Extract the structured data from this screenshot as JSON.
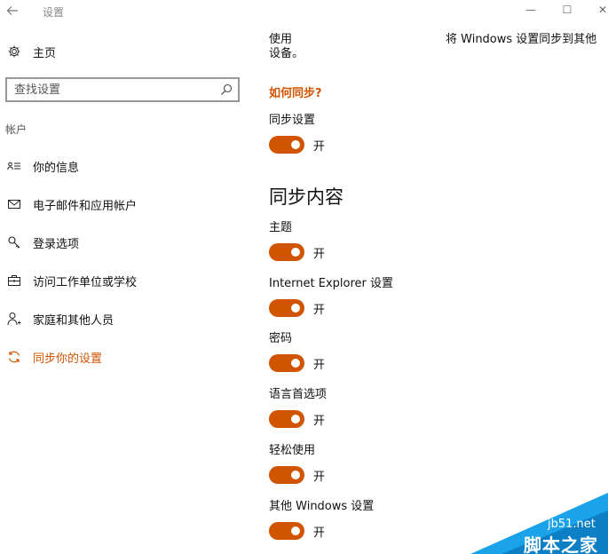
{
  "window": {
    "title": "设置",
    "back_icon": "arrow-left-icon",
    "minimize": "—",
    "maximize": "☐",
    "close": "✕"
  },
  "sidebar": {
    "home_label": "主页",
    "home_icon": "gear-icon",
    "search_placeholder": "查找设置",
    "search_icon": "search-icon",
    "section_label": "帐户",
    "items": [
      {
        "label": "你的信息",
        "icon": "person-card-icon"
      },
      {
        "label": "电子邮件和应用帐户",
        "icon": "mail-icon"
      },
      {
        "label": "登录选项",
        "icon": "key-icon"
      },
      {
        "label": "访问工作单位或学校",
        "icon": "briefcase-icon"
      },
      {
        "label": "家庭和其他人员",
        "icon": "person-add-icon"
      },
      {
        "label": "同步你的设置",
        "icon": "sync-icon",
        "active": true
      }
    ]
  },
  "main": {
    "intro_left_line1": "使用",
    "intro_left_line2": "设备。",
    "intro_right": "将 Windows 设置同步到其他",
    "how_link": "如何同步?",
    "sync_settings": {
      "title": "同步设置",
      "state": "开"
    },
    "section_heading": "同步内容",
    "toggles": [
      {
        "title": "主题",
        "state": "开"
      },
      {
        "title": "Internet Explorer 设置",
        "state": "开"
      },
      {
        "title": "密码",
        "state": "开"
      },
      {
        "title": "语言首选项",
        "state": "开"
      },
      {
        "title": "轻松使用",
        "state": "开"
      },
      {
        "title": "其他 Windows 设置",
        "state": "开"
      }
    ]
  },
  "watermark": {
    "url": "jb51.net",
    "name": "脚本之家"
  },
  "colors": {
    "accent": "#d15400",
    "toggle_on": "#d15400",
    "background": "#ffffff"
  }
}
